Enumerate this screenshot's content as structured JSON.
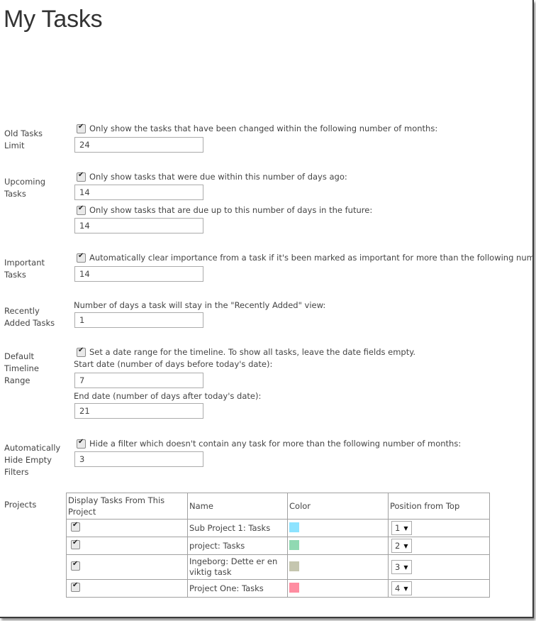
{
  "page": {
    "title": "My Tasks"
  },
  "sections": {
    "old_tasks": {
      "label": "Old Tasks Limit",
      "checkbox_label": "Only show the tasks that have been changed within the following number of months:",
      "checked": true,
      "value": "24"
    },
    "upcoming": {
      "label": "Upcoming Tasks",
      "past_checkbox_label": "Only show tasks that were due within this number of days ago:",
      "past_checked": true,
      "past_value": "14",
      "future_checkbox_label": "Only show tasks that are due up to this number of days in the future:",
      "future_checked": true,
      "future_value": "14"
    },
    "important": {
      "label": "Important Tasks",
      "checkbox_label": "Automatically clear importance from a task if it's been marked as important for more than the following num",
      "checked": true,
      "value": "14"
    },
    "recently_added": {
      "label": "Recently Added Tasks",
      "description": "Number of days a task will stay in the \"Recently Added\" view:",
      "value": "1"
    },
    "timeline": {
      "label": "Default Timeline Range",
      "checkbox_label": "Set a date range for the timeline. To show all tasks, leave the date fields empty.",
      "checked": true,
      "start_label": "Start date (number of days before today's date):",
      "start_value": "7",
      "end_label": "End date (number of days after today's date):",
      "end_value": "21"
    },
    "hide_filters": {
      "label": "Automatically Hide Empty Filters",
      "checkbox_label": "Hide a filter which doesn't contain any task for more than the following number of months:",
      "checked": true,
      "value": "3"
    },
    "projects": {
      "label": "Projects",
      "headers": [
        "Display Tasks From This Project",
        "Name",
        "Color",
        "Position from Top"
      ],
      "rows": [
        {
          "display": true,
          "name": "Sub Project 1: Tasks",
          "color": "#8de3ff",
          "position": "1"
        },
        {
          "display": true,
          "name": "project: Tasks",
          "color": "#90d9b2",
          "position": "2"
        },
        {
          "display": true,
          "name": "Ingeborg: Dette er en viktig task",
          "color": "#c5c6af",
          "position": "3"
        },
        {
          "display": true,
          "name": "Project One: Tasks",
          "color": "#ff8da1",
          "position": "4"
        }
      ]
    }
  },
  "icons": {
    "checkbox_checked": "checkmark-icon",
    "dropdown_arrow": "triangle-down-icon"
  }
}
